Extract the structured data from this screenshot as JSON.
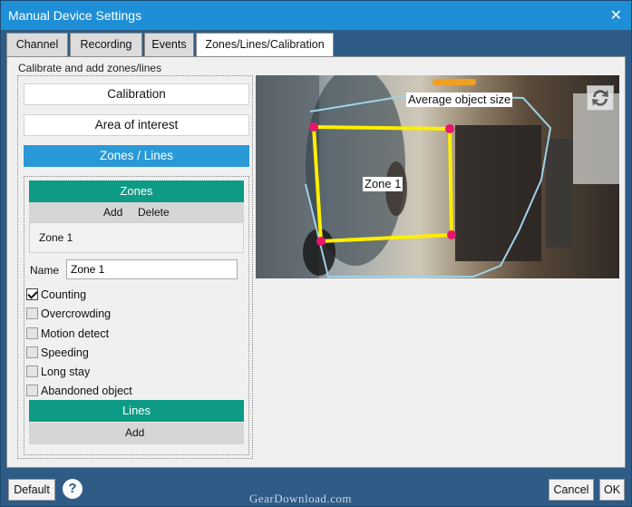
{
  "window": {
    "title": "Manual Device Settings",
    "close_glyph": "✕"
  },
  "tabs": [
    {
      "label": "Channel",
      "active": false
    },
    {
      "label": "Recording",
      "active": false
    },
    {
      "label": "Events",
      "active": false
    },
    {
      "label": "Zones/Lines/Calibration",
      "active": true
    }
  ],
  "group": {
    "label": "Calibrate and add zones/lines"
  },
  "mode_buttons": [
    {
      "label": "Calibration",
      "active": false
    },
    {
      "label": "Area of interest",
      "active": false
    },
    {
      "label": "Zones / Lines",
      "active": true
    }
  ],
  "zones": {
    "header": "Zones",
    "add_label": "Add",
    "delete_label": "Delete",
    "items": [
      "Zone 1"
    ],
    "name_label": "Name",
    "name_value": "Zone 1",
    "options": [
      {
        "label": "Counting",
        "checked": true
      },
      {
        "label": "Overcrowding",
        "checked": false
      },
      {
        "label": "Motion detect",
        "checked": false
      },
      {
        "label": "Speeding",
        "checked": false
      },
      {
        "label": "Long stay",
        "checked": false
      },
      {
        "label": "Abandoned object",
        "checked": false
      }
    ]
  },
  "lines": {
    "header": "Lines",
    "add_label": "Add"
  },
  "camera": {
    "avg_object_label": "Average object size",
    "zone_label": "Zone 1",
    "rotate_icon": "rotate-arrows-icon",
    "zone_color": "#ffee00",
    "vertex_color": "#e8156d",
    "aoi_color": "#9fd3ea"
  },
  "footer": {
    "default_label": "Default",
    "help_glyph": "?",
    "cancel_label": "Cancel",
    "ok_label": "OK",
    "watermark": "GearDownload.com"
  }
}
